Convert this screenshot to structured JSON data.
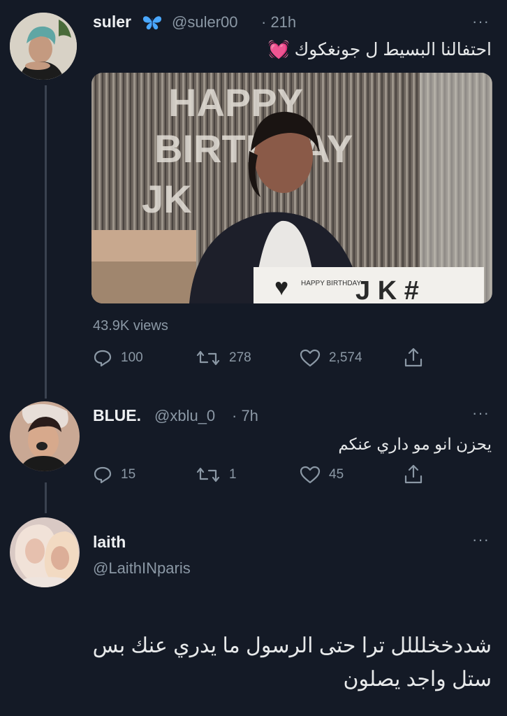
{
  "tweet1": {
    "name": "suler",
    "badge_icon": "butterfly-icon",
    "handle": "@suler00",
    "time": "· 21h",
    "more": "···",
    "text": "احتفالنا البسيط ل جونغكوك 💓",
    "media": {
      "banner_text": "HAPPY BIRTHDAY JK",
      "cake_text": "HAPPY BIRTHDAY",
      "cake_letters": "J K #"
    },
    "views": "43.9K views",
    "replies": "100",
    "retweets": "278",
    "likes": "2,574"
  },
  "tweet2": {
    "name": "BLUE.",
    "handle": "@xblu_0",
    "time": "· 7h",
    "more": "···",
    "text": "يحزن انو مو داري عنكم",
    "replies": "15",
    "retweets": "1",
    "likes": "45"
  },
  "tweet3": {
    "name": "laith",
    "handle": "@LaithINparis",
    "more": "···",
    "text_line1": "شددخخلللل ترا حتى الرسول ما يدري عنك بس",
    "text_line2": "ستل واجد يصلون"
  },
  "colors": {
    "background": "#141a26",
    "text": "#e7e9ea",
    "muted": "#8b98a5",
    "thread_line": "#3a4250",
    "verified_butterfly": "#4aa8ff"
  }
}
